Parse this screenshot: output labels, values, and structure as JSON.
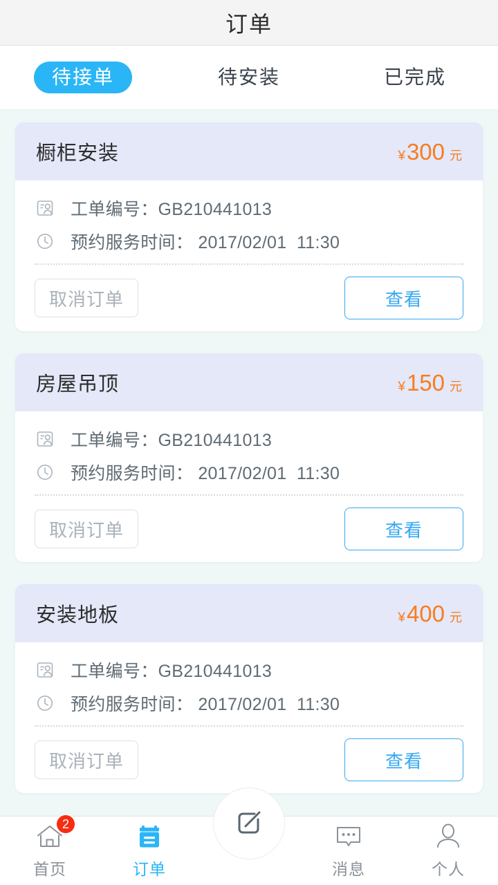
{
  "header": {
    "title": "订单"
  },
  "tabs": [
    {
      "label": "待接单",
      "active": true
    },
    {
      "label": "待安装",
      "active": false
    },
    {
      "label": "已完成",
      "active": false
    }
  ],
  "labels": {
    "order_no_label": "工单编号：",
    "appointment_label": "预约服务时间：",
    "cancel": "取消订单",
    "view": "查看",
    "currency_symbol": "¥",
    "currency_unit": "元"
  },
  "orders": [
    {
      "title": "橱柜安装",
      "price": "300",
      "currency_symbol": "¥",
      "currency_unit": "元",
      "order_no_text": "工单编号：GB210441013",
      "appointment_text": "预约服务时间： 2017/02/01  11:30",
      "cancel_label": "取消订单",
      "view_label": "查看"
    },
    {
      "title": "房屋吊顶",
      "price": "150",
      "currency_symbol": "¥",
      "currency_unit": "元",
      "order_no_text": "工单编号：GB210441013",
      "appointment_text": "预约服务时间： 2017/02/01  11:30",
      "cancel_label": "取消订单",
      "view_label": "查看"
    },
    {
      "title": "安装地板",
      "price": "400",
      "currency_symbol": "¥",
      "currency_unit": "元",
      "order_no_text": "工单编号：GB210441013",
      "appointment_text": "预约服务时间： 2017/02/01  11:30",
      "cancel_label": "取消订单",
      "view_label": "查看"
    }
  ],
  "navbar": {
    "items": [
      {
        "label": "首页",
        "icon": "home-icon",
        "active": false,
        "badge": "2"
      },
      {
        "label": "订单",
        "icon": "orders-icon",
        "active": true,
        "badge": ""
      },
      {
        "label": "消息",
        "icon": "message-icon",
        "active": false,
        "badge": ""
      },
      {
        "label": "个人",
        "icon": "profile-icon",
        "active": false,
        "badge": ""
      }
    ],
    "compose_icon": "compose-icon"
  },
  "colors": {
    "accent": "#2ab6f6",
    "price": "#f77c20",
    "badge": "#f72c10",
    "card_header_bg": "#e4e8f8",
    "page_bg": "#f0f7f7"
  }
}
